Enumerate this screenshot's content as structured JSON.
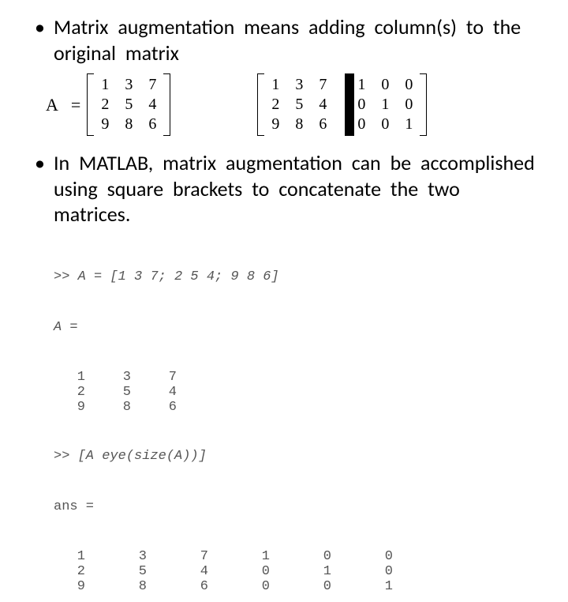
{
  "bullets": {
    "b1": "Matrix augmentation means adding column(s) to the original matrix",
    "b2": "In MATLAB, matrix augmentation can be accomplished using square brackets to concatenate the two matrices."
  },
  "eq": {
    "lhs": "A",
    "eq_sign": "="
  },
  "matrix_A": {
    "r0c0": "1",
    "r0c1": "3",
    "r0c2": "7",
    "r1c0": "2",
    "r1c1": "5",
    "r1c2": "4",
    "r2c0": "9",
    "r2c1": "8",
    "r2c2": "6"
  },
  "matrix_aug": {
    "a00": "1",
    "a01": "3",
    "a02": "7",
    "a10": "2",
    "a11": "5",
    "a12": "4",
    "a20": "9",
    "a21": "8",
    "a22": "6",
    "b00": "1",
    "b01": "0",
    "b02": "0",
    "b10": "0",
    "b11": "1",
    "b12": "0",
    "b20": "0",
    "b21": "0",
    "b22": "1"
  },
  "code": {
    "l1": ">> A = [1 3 7; 2 5 4; 9 8 6]",
    "l2": "A =",
    "l3": ">> [A eye(size(A))]",
    "l4": "ans ="
  },
  "matA_out": {
    "r0": [
      "1",
      "3",
      "7"
    ],
    "r1": [
      "2",
      "5",
      "4"
    ],
    "r2": [
      "9",
      "8",
      "6"
    ]
  },
  "aug_out": {
    "r0": [
      "1",
      "3",
      "7",
      "1",
      "0",
      "0"
    ],
    "r1": [
      "2",
      "5",
      "4",
      "0",
      "1",
      "0"
    ],
    "r2": [
      "9",
      "8",
      "6",
      "0",
      "0",
      "1"
    ]
  }
}
